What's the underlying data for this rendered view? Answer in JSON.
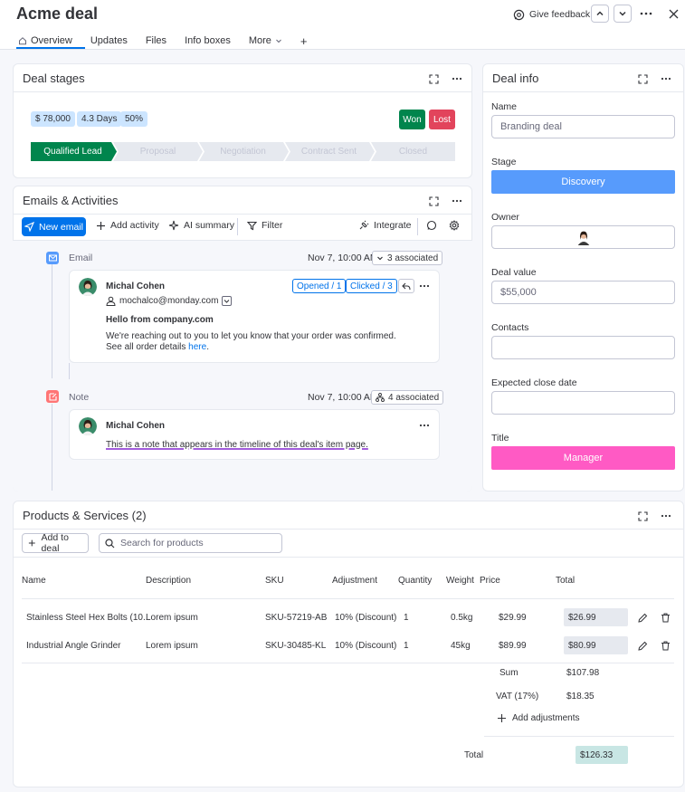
{
  "app": {
    "title": "Acme deal",
    "give_feedback": "Give feedback",
    "tabs": [
      {
        "label": "Overview"
      },
      {
        "label": "Updates"
      },
      {
        "label": "Files"
      },
      {
        "label": "Info boxes"
      },
      {
        "label": "More"
      }
    ],
    "add_tab": "+"
  },
  "deal_stages": {
    "title": "Deal stages",
    "chips": [
      "$ 78,000",
      "4.3 Days",
      "50%"
    ],
    "won": "Won",
    "lost": "Lost",
    "stages": [
      "Qualified Lead",
      "Proposal",
      "Negotiation",
      "Contract Sent",
      "Closed"
    ],
    "active_stage_index": 0,
    "colors": {
      "active": "#00854d",
      "inactive": "#e6e9ef",
      "won": "#00854d",
      "lost": "#e2445c"
    }
  },
  "activities": {
    "title": "Emails & Activities",
    "toolbar": {
      "new_email": "New email",
      "add_activity": "Add activity",
      "ai_summary": "AI summary",
      "filter": "Filter",
      "integrate": "Integrate"
    },
    "items": [
      {
        "type": "Email",
        "date": "Nov 7, 10:00 AM",
        "associated": "3 associated",
        "author": "Michal Cohen",
        "email": "mochalco@monday.com",
        "opened": "Opened / 1",
        "clicked": "Clicked / 3",
        "subject": "Hello from company.com",
        "body_line1": "We're reaching out to you to let you know that your order was confirmed.",
        "body_line2_prefix": "See all order details ",
        "body_link": "here",
        "body_suffix": "."
      },
      {
        "type": "Note",
        "date": "Nov 7, 10:00 AM",
        "associated": "4 associated",
        "author": "Michal Cohen",
        "text": "This is a note that appears in the timeline of this deal's item page."
      }
    ]
  },
  "deal_info": {
    "title": "Deal info",
    "fields": {
      "name_label": "Name",
      "name_value": "Branding deal",
      "stage_label": "Stage",
      "stage_value": "Discovery",
      "owner_label": "Owner",
      "deal_value_label": "Deal value",
      "deal_value": "$55,000",
      "contacts_label": "Contacts",
      "close_date_label": "Expected close date",
      "title_label": "Title",
      "title_value": "Manager"
    },
    "colors": {
      "stage": "#579bfc",
      "title": "#ff5ac4"
    }
  },
  "products": {
    "title": "Products & Services (2)",
    "add_to_deal": "Add to deal",
    "search_placeholder": "Search for products",
    "columns": [
      "Name",
      "Description",
      "SKU",
      "Adjustment",
      "Quantity",
      "Weight",
      "Price",
      "Total"
    ],
    "rows": [
      {
        "name": "Stainless Steel Hex Bolts (10...",
        "description": "Lorem ipsum",
        "sku": "SKU-57219-AB",
        "adjustment": "10% (Discount)",
        "quantity": "1",
        "weight": "0.5kg",
        "price": "$29.99",
        "total": "$26.99"
      },
      {
        "name": "Industrial Angle Grinder",
        "description": "Lorem ipsum",
        "sku": "SKU-30485-KL",
        "adjustment": "10% (Discount)",
        "quantity": "1",
        "weight": "45kg",
        "price": "$89.99",
        "total": "$80.99"
      }
    ],
    "sum_label": "Sum",
    "sum_value": "$107.98",
    "vat_label": "VAT (17%)",
    "vat_value": "$18.35",
    "add_adjustments": "Add adjustments",
    "total_label": "Total",
    "total_value": "$126.33",
    "total_color": "#c8e6e4"
  }
}
